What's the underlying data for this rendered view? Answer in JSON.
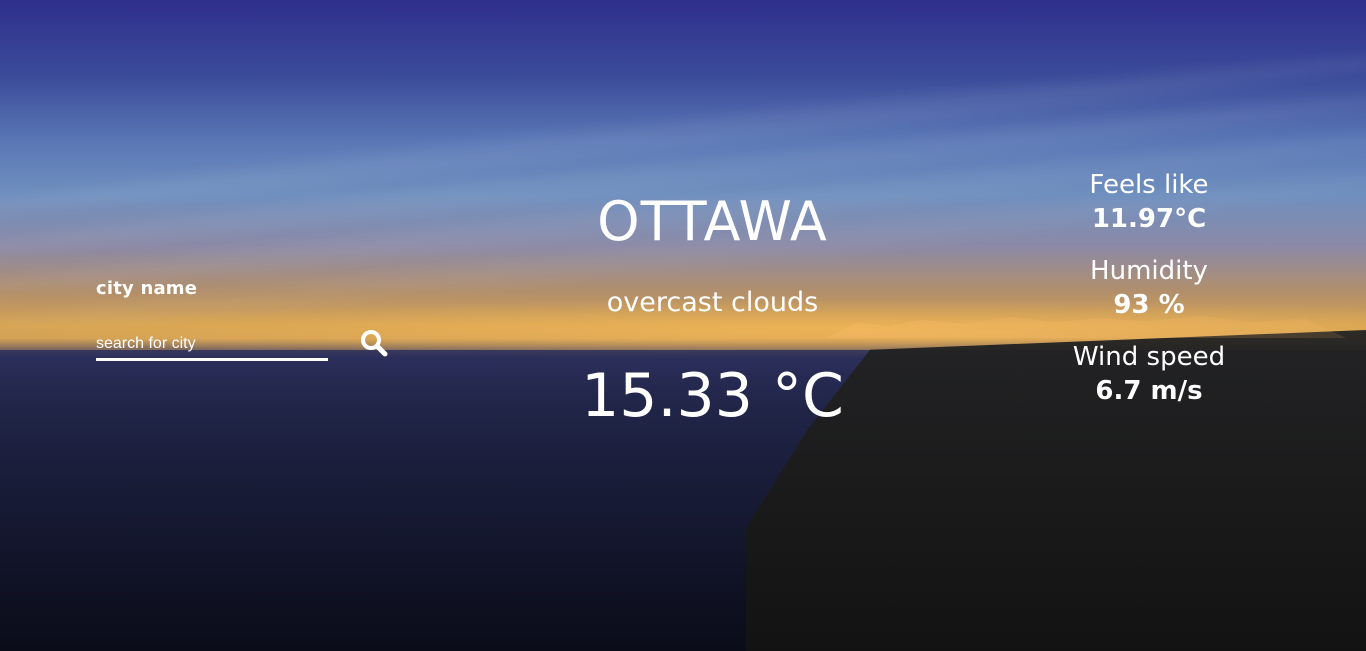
{
  "search": {
    "label": "city name",
    "placeholder": "search for city"
  },
  "weather": {
    "city": "OTTAWA",
    "description": "overcast clouds",
    "temperature": "15.33 °C"
  },
  "stats": [
    {
      "title": "Feels like",
      "value": "11.97°C"
    },
    {
      "title": "Humidity",
      "value": "93 %"
    },
    {
      "title": "Wind speed",
      "value": "6.7 m/s"
    }
  ],
  "icons": {
    "search": "search-icon"
  },
  "colors": {
    "text": "#ffffff"
  }
}
